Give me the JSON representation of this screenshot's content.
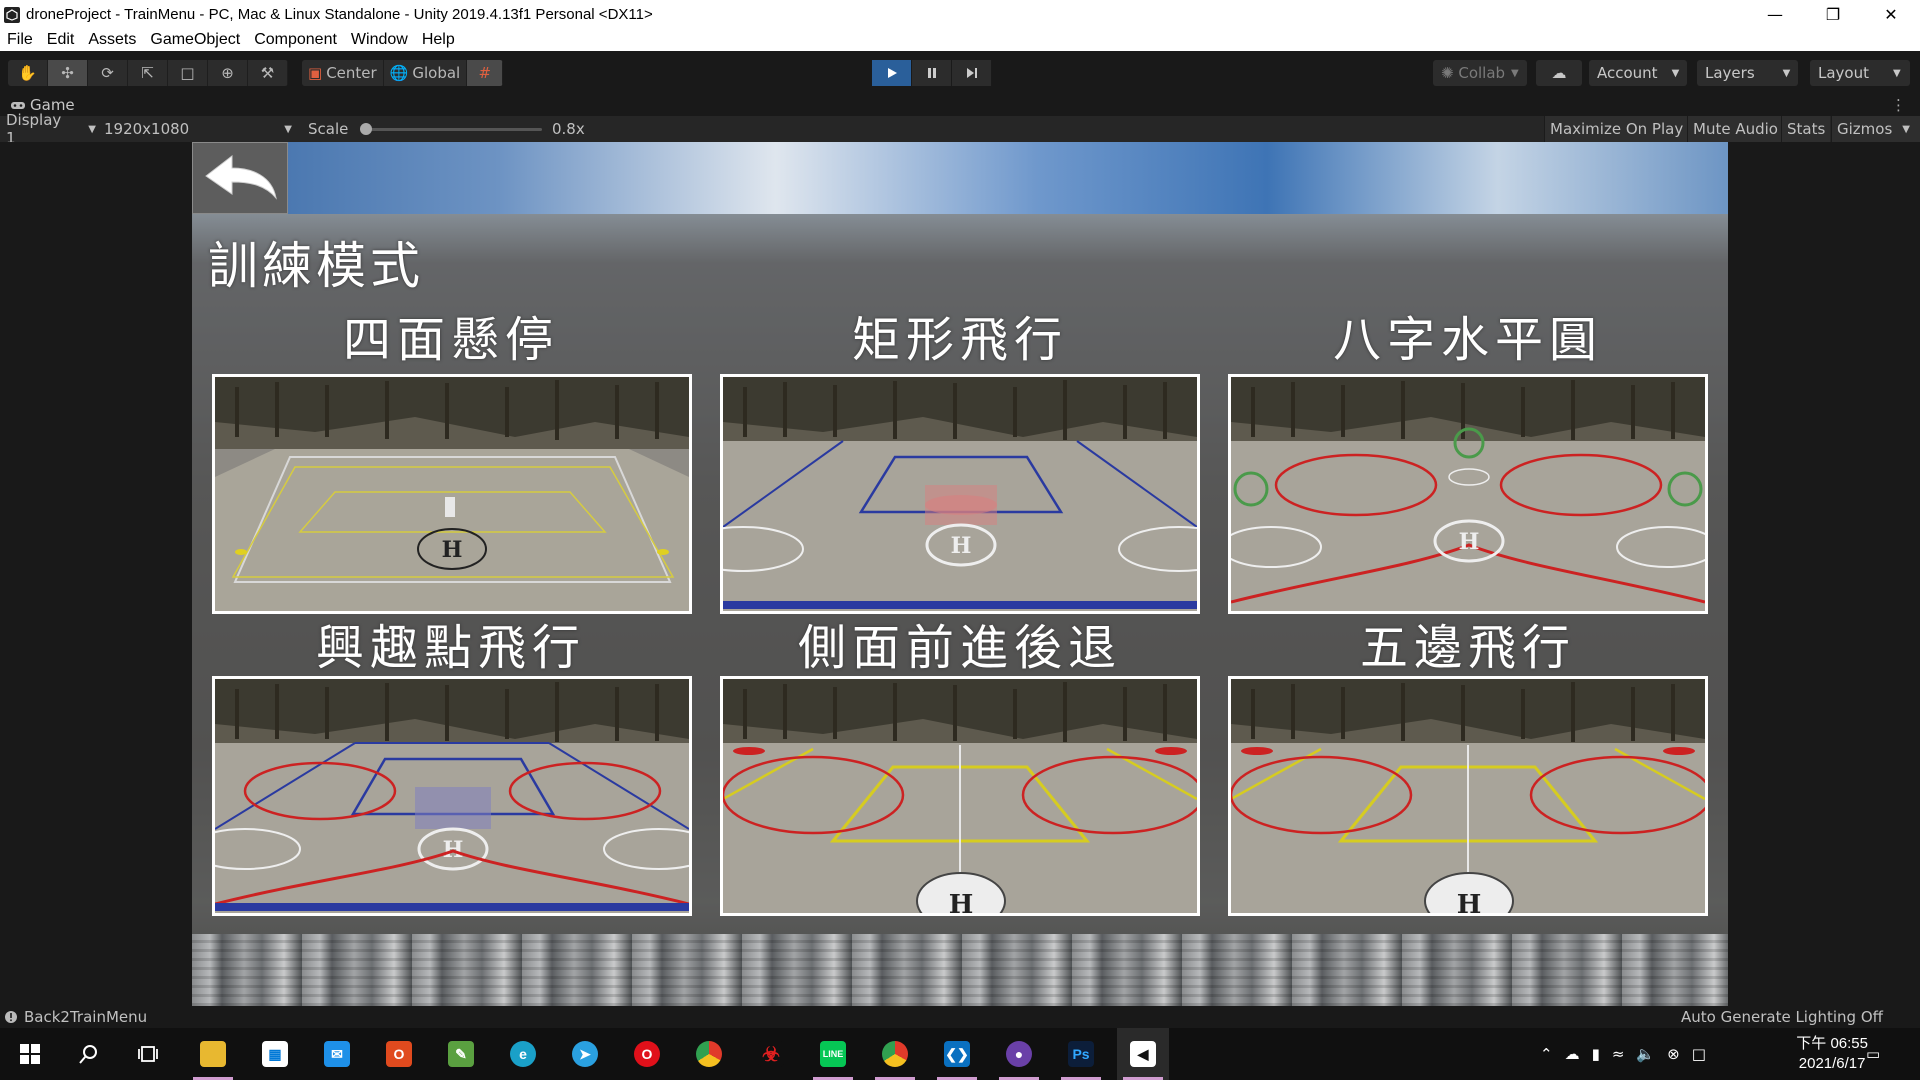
{
  "window": {
    "title": "droneProject - TrainMenu - PC, Mac & Linux Standalone - Unity 2019.4.13f1 Personal <DX11>"
  },
  "menu": [
    "File",
    "Edit",
    "Assets",
    "GameObject",
    "Component",
    "Window",
    "Help"
  ],
  "toolbar": {
    "pivot_label": "Center",
    "space_label": "Global",
    "collab_label": "Collab",
    "account_label": "Account",
    "layers_label": "Layers",
    "layout_label": "Layout"
  },
  "game_tab": {
    "label": "Game"
  },
  "game_bar": {
    "display": "Display 1",
    "resolution": "1920x1080",
    "scale_label": "Scale",
    "scale_value": "0.8x",
    "maximize_on_play": "Maximize On Play",
    "mute_audio": "Mute Audio",
    "stats": "Stats",
    "gizmos": "Gizmos"
  },
  "game": {
    "heading": "訓練模式",
    "cards": [
      {
        "title": "四面懸停",
        "scene": "hover"
      },
      {
        "title": "矩形飛行",
        "scene": "rect"
      },
      {
        "title": "八字水平圓",
        "scene": "eight"
      },
      {
        "title": "興趣點飛行",
        "scene": "poi"
      },
      {
        "title": "側面前進後退",
        "scene": "side"
      },
      {
        "title": "五邊飛行",
        "scene": "pentagon"
      }
    ]
  },
  "status": {
    "message": "Back2TrainMenu",
    "lighting": "Auto Generate Lighting Off"
  },
  "taskbar": {
    "apps": [
      "start",
      "search",
      "task-view",
      "file-explorer",
      "store",
      "mail",
      "office",
      "notepad",
      "edge",
      "telegram",
      "opera",
      "chrome",
      "garena",
      "line",
      "chrome",
      "vscode",
      "github",
      "photoshop",
      "unity"
    ],
    "time": "下午 06:55",
    "date": "2021/6/17"
  },
  "colors": {
    "editor_bg": "#191919",
    "play_active": "#2a5f9a",
    "card_border": "#ffffff"
  }
}
